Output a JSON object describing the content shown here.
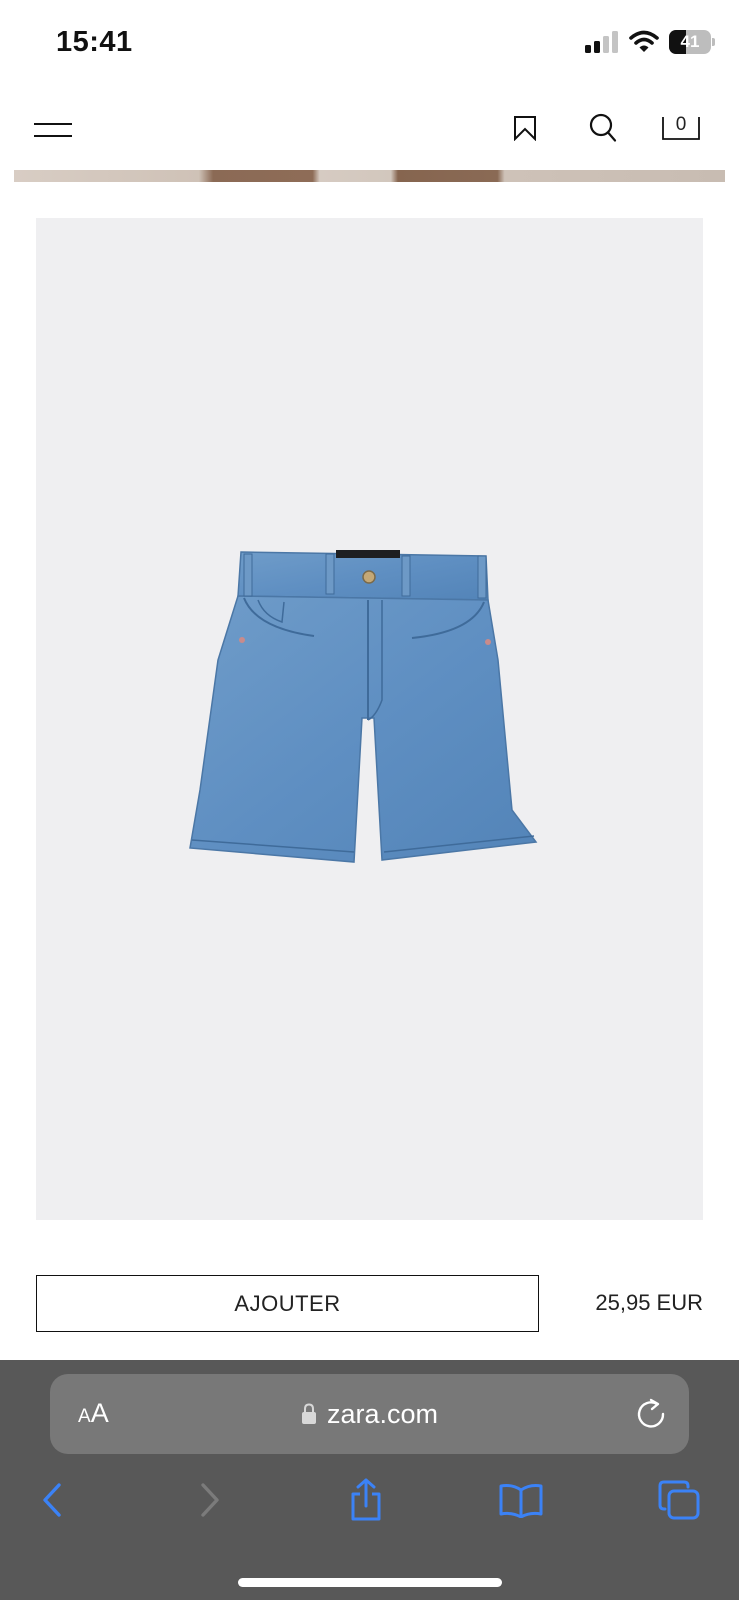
{
  "status_bar": {
    "time": "15:41",
    "battery_level": "41",
    "icons": [
      "signal-icon",
      "wifi-icon",
      "battery-icon"
    ]
  },
  "header": {
    "icons": [
      "menu-icon",
      "bookmark-icon",
      "search-icon",
      "shopping-bag-icon"
    ],
    "bag_count": "0"
  },
  "product": {
    "image_subject": "denim-shorts",
    "add_label": "AJOUTER",
    "price": "25,95 EUR"
  },
  "browser": {
    "text_size_small": "A",
    "text_size_big": "A",
    "url": "zara.com",
    "toolbar_icons": [
      "back-icon",
      "forward-icon",
      "share-icon",
      "bookmarks-icon",
      "tabs-icon"
    ],
    "accent_color": "#3b82f6"
  }
}
